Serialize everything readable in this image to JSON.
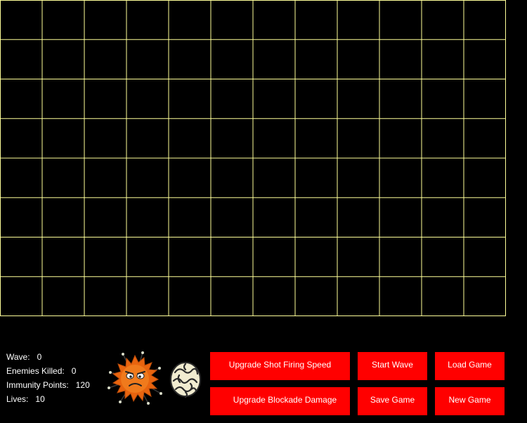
{
  "board": {
    "cols": 12,
    "rows": 8,
    "grid_color": "#ffff99",
    "background": "#000000"
  },
  "stats": {
    "wave_label": "Wave:",
    "wave_value": "0",
    "enemies_label": "Enemies Killed:",
    "enemies_value": "0",
    "immunity_label": "Immunity Points:",
    "immunity_value": "120",
    "lives_label": "Lives:",
    "lives_value": "10"
  },
  "towers": [
    {
      "name": "orange-virus-tower-icon"
    },
    {
      "name": "blockade-tower-icon"
    }
  ],
  "buttons": {
    "upgrade_shot": "Upgrade Shot Firing Speed",
    "upgrade_blockade": "Upgrade Blockade Damage",
    "start_wave": "Start Wave",
    "save_game": "Save Game",
    "load_game": "Load Game",
    "new_game": "New Game"
  },
  "colors": {
    "button_bg": "#ff0000",
    "button_text": "#ffffff",
    "text": "#ffffff"
  }
}
